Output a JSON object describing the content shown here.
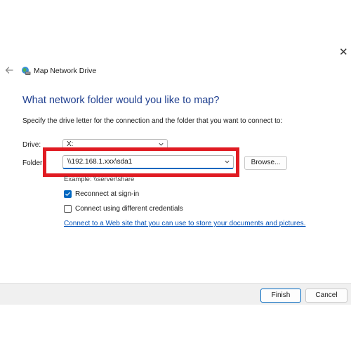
{
  "window": {
    "title": "Map Network Drive",
    "close_glyph": "✕"
  },
  "icons": {
    "back": "back-arrow-icon",
    "app": "network-drive-icon",
    "chevron": "chevron-down-icon",
    "check": "checkmark-icon"
  },
  "colors": {
    "heading": "#1f3f8f",
    "accent": "#0067c0",
    "highlight_box": "#e01b22",
    "link": "#0050b8"
  },
  "main": {
    "heading": "What network folder would you like to map?",
    "instructions": "Specify the drive letter for the connection and the folder that you want to connect to:"
  },
  "form": {
    "drive": {
      "label": "Drive:",
      "value": "X:"
    },
    "folder": {
      "label": "Folder:",
      "value": "\\\\192.168.1.xxx\\sda1"
    },
    "browse_label": "Browse...",
    "example": "Example: \\\\server\\share",
    "reconnect": {
      "label": "Reconnect at sign-in",
      "checked": true
    },
    "different_credentials": {
      "label": "Connect using different credentials",
      "checked": false
    },
    "web_link": "Connect to a Web site that you can use to store your documents and pictures."
  },
  "footer": {
    "finish_label": "Finish",
    "cancel_label": "Cancel"
  }
}
